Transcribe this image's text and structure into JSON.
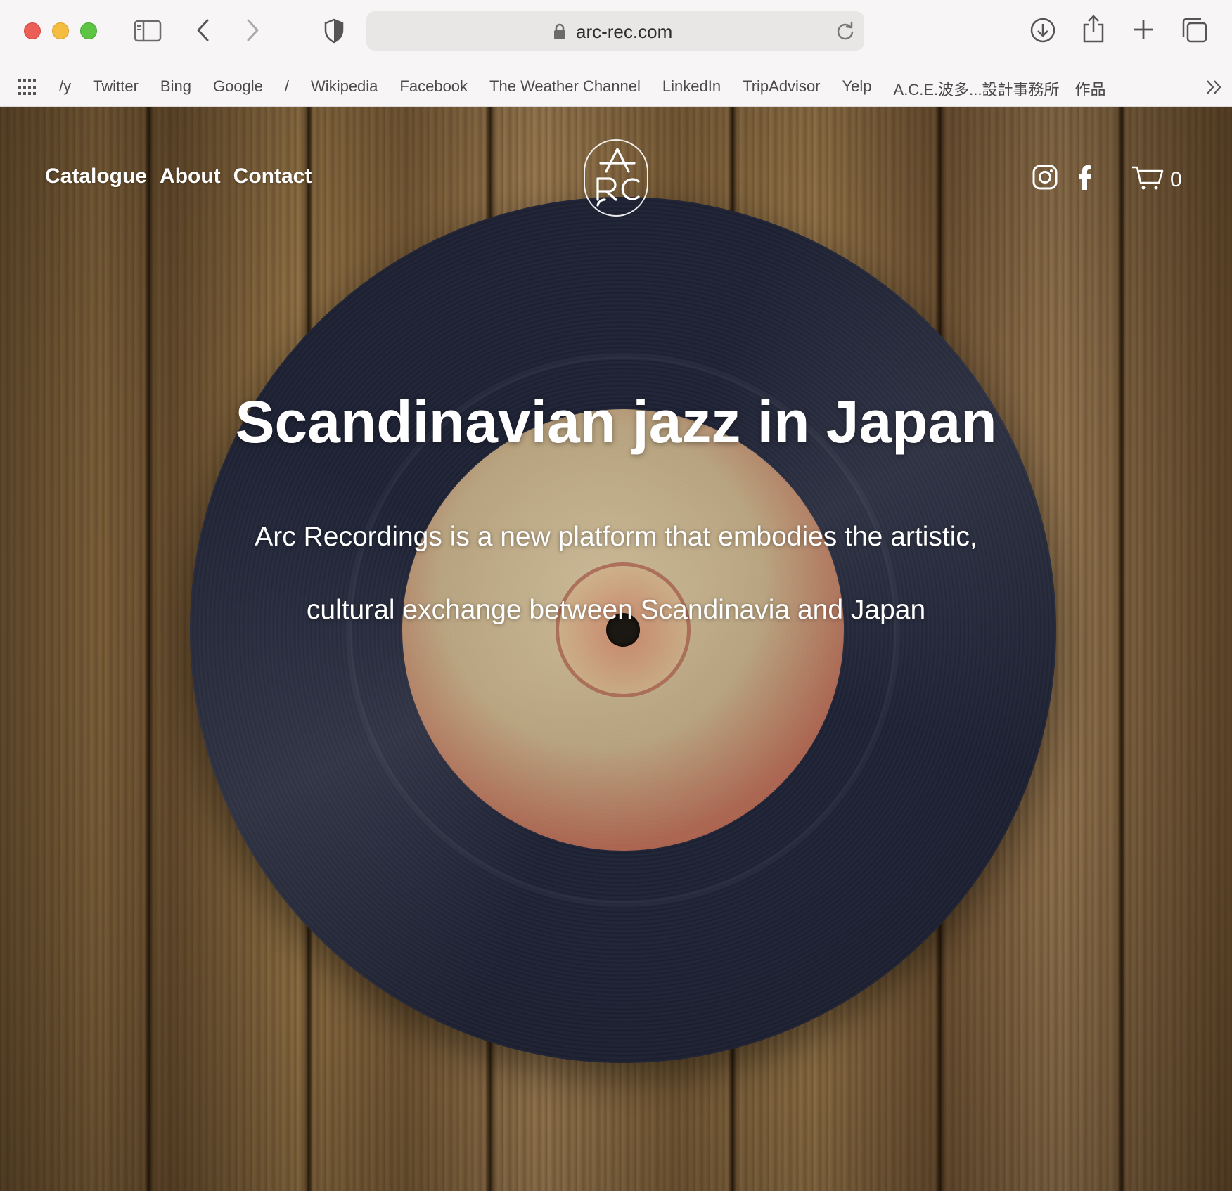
{
  "browser": {
    "url": "arc-rec.com",
    "bookmarks": [
      "/y",
      "Twitter",
      "Bing",
      "Google",
      "/",
      "Wikipedia",
      "Facebook",
      "The Weather Channel",
      "LinkedIn",
      "TripAdvisor",
      "Yelp",
      "A.C.E.波多...設計事務所｜作品"
    ]
  },
  "site": {
    "nav": {
      "catalogue": "Catalogue",
      "about": "About",
      "contact": "Contact"
    },
    "cart_count": "0",
    "hero": {
      "title": "Scandinavian jazz in Japan",
      "subtitle": "Arc Recordings is a new platform that embodies the artistic, cultural exchange between Scandinavia and Japan"
    }
  },
  "icons": {
    "logo": "arc-logo",
    "social": [
      "instagram-icon",
      "facebook-icon"
    ],
    "cart": "cart-icon"
  },
  "colors": {
    "traffic_close": "#ec5f57",
    "traffic_minimize": "#f4bd3f",
    "traffic_maximize": "#5dc543",
    "record": "#1f2336",
    "label": "#c4503c"
  }
}
